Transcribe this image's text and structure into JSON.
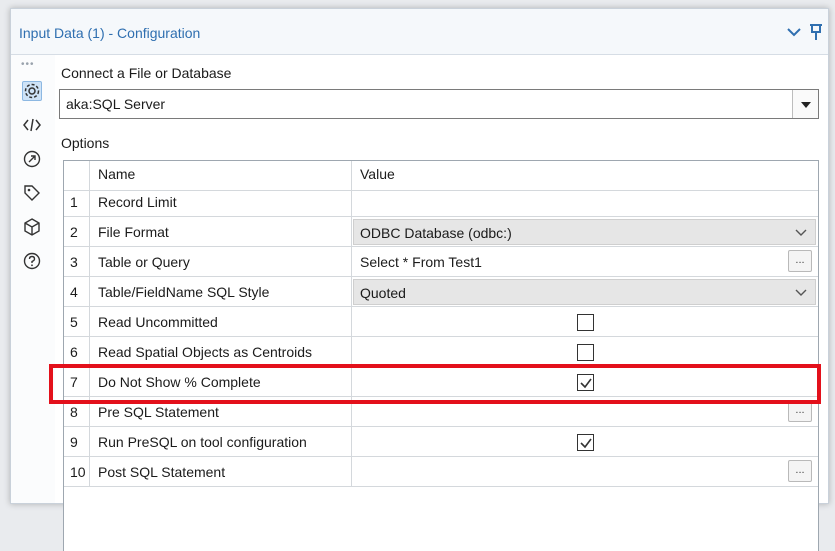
{
  "window": {
    "title": "Input Data (1) - Configuration",
    "icons": [
      "chevron-down-icon",
      "pin-icon"
    ]
  },
  "sidebar": {
    "icons": [
      "settings-icon",
      "code-icon",
      "metadata-icon",
      "tag-icon",
      "box-icon",
      "help-icon"
    ]
  },
  "connect": {
    "label": "Connect a File or Database",
    "value": "aka:SQL Server"
  },
  "options": {
    "label": "Options",
    "columns": {
      "name": "Name",
      "value": "Value"
    },
    "rows": [
      {
        "num": "1",
        "name": "Record Limit",
        "value_type": "text",
        "value": ""
      },
      {
        "num": "2",
        "name": "File Format",
        "value_type": "dropdown",
        "value": "ODBC Database (odbc:)"
      },
      {
        "num": "3",
        "name": "Table or Query",
        "value_type": "text-ellipsis",
        "value": "Select * From Test1"
      },
      {
        "num": "4",
        "name": "Table/FieldName SQL Style",
        "value_type": "dropdown",
        "value": "Quoted"
      },
      {
        "num": "5",
        "name": "Read Uncommitted",
        "value_type": "checkbox",
        "checked": false
      },
      {
        "num": "6",
        "name": "Read Spatial Objects as Centroids",
        "value_type": "checkbox",
        "checked": false
      },
      {
        "num": "7",
        "name": "Do Not Show % Complete",
        "value_type": "checkbox",
        "checked": true
      },
      {
        "num": "8",
        "name": "Pre SQL Statement",
        "value_type": "ellipsis",
        "value": ""
      },
      {
        "num": "9",
        "name": "Run PreSQL on tool configuration",
        "value_type": "checkbox",
        "checked": true
      },
      {
        "num": "10",
        "name": "Post SQL Statement",
        "value_type": "ellipsis",
        "value": ""
      }
    ],
    "ellipsis_label": "...",
    "highlight_color": "#e3101b"
  },
  "colors": {
    "title": "#2f6fb0",
    "accent": "#8db8e2"
  }
}
